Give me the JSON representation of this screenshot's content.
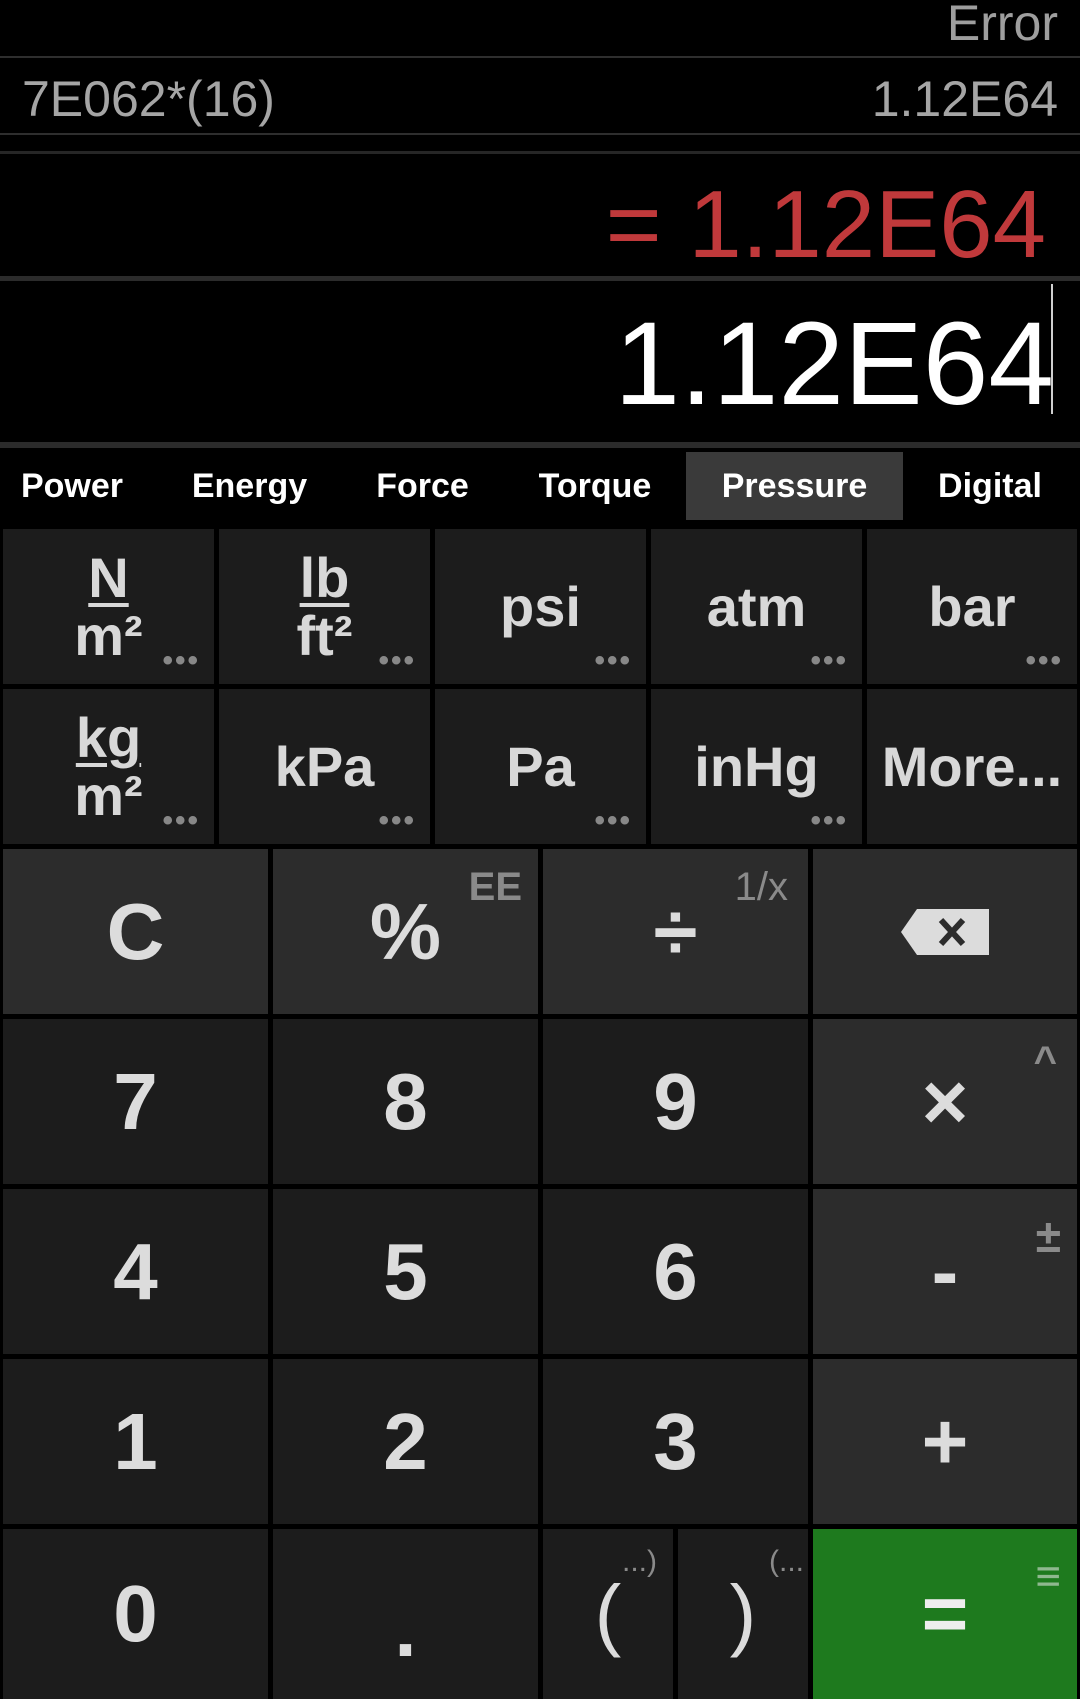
{
  "display": {
    "history_label": "Error",
    "history_expression": "7E062*(16)",
    "history_result": "1.12E64",
    "result": "= 1.12E64",
    "input": "1.12E64"
  },
  "tabs": [
    "Power",
    "Energy",
    "Force",
    "Torque",
    "Pressure",
    "Digital"
  ],
  "active_tab": "Pressure",
  "units": {
    "n_m2": {
      "num": "N",
      "den": "m²"
    },
    "lb_ft2": {
      "num": "lb",
      "den": "ft²"
    },
    "psi": "psi",
    "atm": "atm",
    "bar": "bar",
    "kg_m2": {
      "num": "kg",
      "den": "m²"
    },
    "kpa": "kPa",
    "pa": "Pa",
    "inhg": "inHg",
    "more": "More...",
    "dots": "•••"
  },
  "keys": {
    "clear": "C",
    "percent": "%",
    "percent_sub": "EE",
    "divide": "÷",
    "divide_sub": "1/x",
    "seven": "7",
    "eight": "8",
    "nine": "9",
    "multiply": "×",
    "multiply_sub": "^",
    "four": "4",
    "five": "5",
    "six": "6",
    "minus": "-",
    "minus_sub": "±",
    "one": "1",
    "two": "2",
    "three": "3",
    "plus": "+",
    "zero": "0",
    "dot": ".",
    "open_paren": "(",
    "open_paren_sub": "...)",
    "close_paren": ")",
    "close_paren_sub": "(...",
    "equals": "=",
    "equals_sub": "≡"
  },
  "colors": {
    "result": "#c0393b",
    "equals_key": "#1e7a1e",
    "active_tab": "#3a3a3a"
  }
}
